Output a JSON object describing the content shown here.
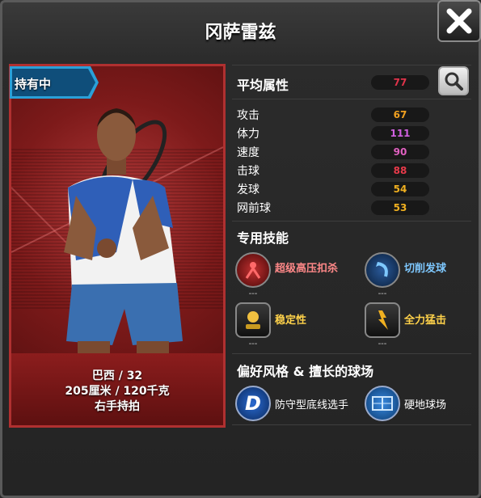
{
  "title": "冈萨雷兹",
  "card": {
    "owned_tag": "持有中",
    "country_age": "巴西 / 32",
    "height_weight": "205厘米 / 120千克",
    "handedness": "右手持拍"
  },
  "attributes": {
    "heading": "平均属性",
    "average": "77",
    "average_color": "#e0334a",
    "stats": [
      {
        "label": "攻击",
        "value": "67",
        "color": "#f0a020"
      },
      {
        "label": "体力",
        "value": "111",
        "color": "#d060e0"
      },
      {
        "label": "速度",
        "value": "90",
        "color": "#e060c0"
      },
      {
        "label": "击球",
        "value": "88",
        "color": "#e83a4a"
      },
      {
        "label": "发球",
        "value": "54",
        "color": "#f0b020"
      },
      {
        "label": "网前球",
        "value": "53",
        "color": "#f0b020"
      }
    ]
  },
  "skills": {
    "heading": "专用技能",
    "items": [
      {
        "label": "超级高压扣杀",
        "icon": "smash-icon",
        "color": "#ff8888",
        "dash": "---"
      },
      {
        "label": "切削发球",
        "icon": "slice-serve-icon",
        "color": "#7ec8ff",
        "dash": "---"
      },
      {
        "label": "稳定性",
        "icon": "stability-icon",
        "color": "#ffd24a",
        "dash": "---"
      },
      {
        "label": "全力猛击",
        "icon": "power-hit-icon",
        "color": "#ffd24a",
        "dash": "---"
      }
    ]
  },
  "style": {
    "heading": "偏好风格 & 擅长的球场",
    "play_style": "防守型底线选手",
    "court": "硬地球场"
  }
}
